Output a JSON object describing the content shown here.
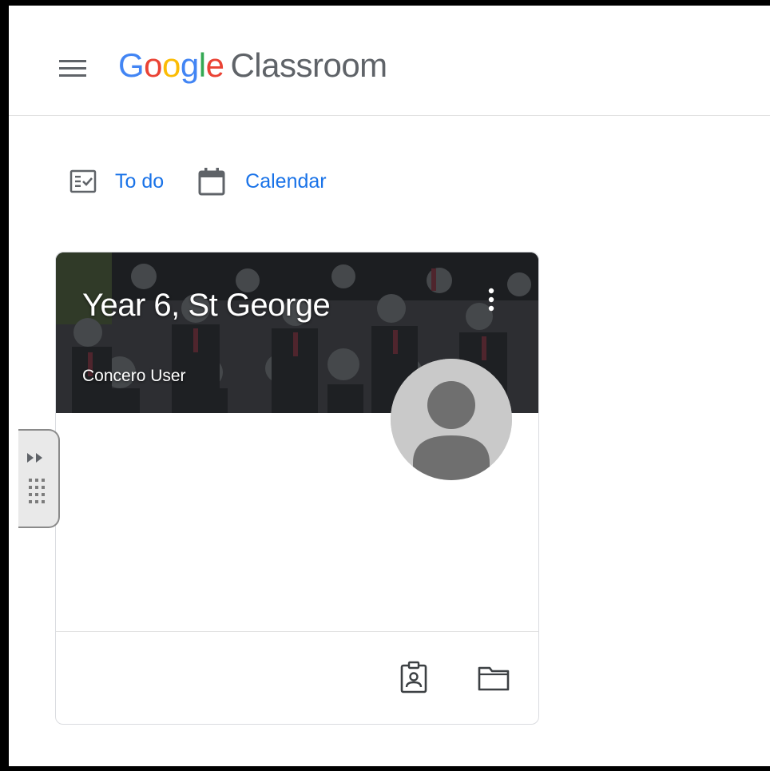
{
  "header": {
    "menu_icon": "hamburger-menu-icon",
    "logo_letters": [
      {
        "char": "G",
        "color": "#4285F4"
      },
      {
        "char": "o",
        "color": "#EA4335"
      },
      {
        "char": "o",
        "color": "#FBBC05"
      },
      {
        "char": "g",
        "color": "#4285F4"
      },
      {
        "char": "l",
        "color": "#34A853"
      },
      {
        "char": "e",
        "color": "#EA4335"
      }
    ],
    "product_name": "Classroom"
  },
  "nav": {
    "todo": {
      "label": "To do",
      "icon": "assignment-check-icon"
    },
    "calendar": {
      "label": "Calendar",
      "icon": "calendar-icon"
    },
    "accent_color": "#1a73e8"
  },
  "class_card": {
    "title": "Year 6, St George",
    "owner": "Concero User",
    "more_icon": "more-vert-icon",
    "avatar_icon": "default-avatar-icon",
    "actions": [
      {
        "name": "gradebook",
        "icon": "portrait-badge-icon"
      },
      {
        "name": "open-folder",
        "icon": "folder-icon"
      }
    ]
  },
  "side_handle": {
    "icons": [
      "double-chevron-right-icon",
      "grip-dots-icon"
    ]
  }
}
